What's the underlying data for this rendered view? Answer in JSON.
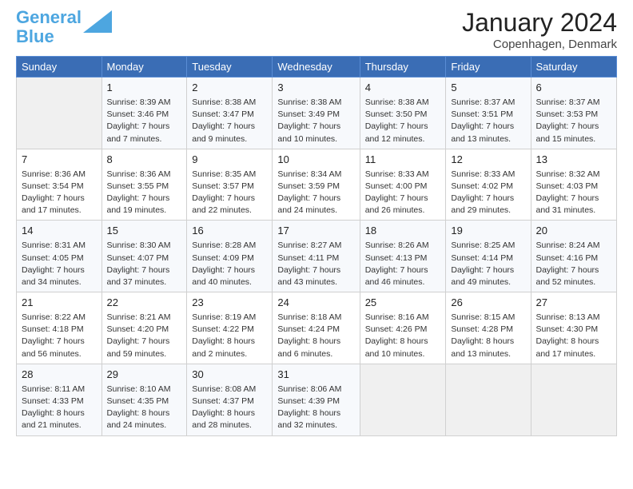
{
  "header": {
    "logo_line1": "General",
    "logo_line2": "Blue",
    "month_year": "January 2024",
    "location": "Copenhagen, Denmark"
  },
  "weekdays": [
    "Sunday",
    "Monday",
    "Tuesday",
    "Wednesday",
    "Thursday",
    "Friday",
    "Saturday"
  ],
  "weeks": [
    [
      {
        "day": "",
        "content": ""
      },
      {
        "day": "1",
        "content": "Sunrise: 8:39 AM\nSunset: 3:46 PM\nDaylight: 7 hours\nand 7 minutes."
      },
      {
        "day": "2",
        "content": "Sunrise: 8:38 AM\nSunset: 3:47 PM\nDaylight: 7 hours\nand 9 minutes."
      },
      {
        "day": "3",
        "content": "Sunrise: 8:38 AM\nSunset: 3:49 PM\nDaylight: 7 hours\nand 10 minutes."
      },
      {
        "day": "4",
        "content": "Sunrise: 8:38 AM\nSunset: 3:50 PM\nDaylight: 7 hours\nand 12 minutes."
      },
      {
        "day": "5",
        "content": "Sunrise: 8:37 AM\nSunset: 3:51 PM\nDaylight: 7 hours\nand 13 minutes."
      },
      {
        "day": "6",
        "content": "Sunrise: 8:37 AM\nSunset: 3:53 PM\nDaylight: 7 hours\nand 15 minutes."
      }
    ],
    [
      {
        "day": "7",
        "content": "Sunrise: 8:36 AM\nSunset: 3:54 PM\nDaylight: 7 hours\nand 17 minutes."
      },
      {
        "day": "8",
        "content": "Sunrise: 8:36 AM\nSunset: 3:55 PM\nDaylight: 7 hours\nand 19 minutes."
      },
      {
        "day": "9",
        "content": "Sunrise: 8:35 AM\nSunset: 3:57 PM\nDaylight: 7 hours\nand 22 minutes."
      },
      {
        "day": "10",
        "content": "Sunrise: 8:34 AM\nSunset: 3:59 PM\nDaylight: 7 hours\nand 24 minutes."
      },
      {
        "day": "11",
        "content": "Sunrise: 8:33 AM\nSunset: 4:00 PM\nDaylight: 7 hours\nand 26 minutes."
      },
      {
        "day": "12",
        "content": "Sunrise: 8:33 AM\nSunset: 4:02 PM\nDaylight: 7 hours\nand 29 minutes."
      },
      {
        "day": "13",
        "content": "Sunrise: 8:32 AM\nSunset: 4:03 PM\nDaylight: 7 hours\nand 31 minutes."
      }
    ],
    [
      {
        "day": "14",
        "content": "Sunrise: 8:31 AM\nSunset: 4:05 PM\nDaylight: 7 hours\nand 34 minutes."
      },
      {
        "day": "15",
        "content": "Sunrise: 8:30 AM\nSunset: 4:07 PM\nDaylight: 7 hours\nand 37 minutes."
      },
      {
        "day": "16",
        "content": "Sunrise: 8:28 AM\nSunset: 4:09 PM\nDaylight: 7 hours\nand 40 minutes."
      },
      {
        "day": "17",
        "content": "Sunrise: 8:27 AM\nSunset: 4:11 PM\nDaylight: 7 hours\nand 43 minutes."
      },
      {
        "day": "18",
        "content": "Sunrise: 8:26 AM\nSunset: 4:13 PM\nDaylight: 7 hours\nand 46 minutes."
      },
      {
        "day": "19",
        "content": "Sunrise: 8:25 AM\nSunset: 4:14 PM\nDaylight: 7 hours\nand 49 minutes."
      },
      {
        "day": "20",
        "content": "Sunrise: 8:24 AM\nSunset: 4:16 PM\nDaylight: 7 hours\nand 52 minutes."
      }
    ],
    [
      {
        "day": "21",
        "content": "Sunrise: 8:22 AM\nSunset: 4:18 PM\nDaylight: 7 hours\nand 56 minutes."
      },
      {
        "day": "22",
        "content": "Sunrise: 8:21 AM\nSunset: 4:20 PM\nDaylight: 7 hours\nand 59 minutes."
      },
      {
        "day": "23",
        "content": "Sunrise: 8:19 AM\nSunset: 4:22 PM\nDaylight: 8 hours\nand 2 minutes."
      },
      {
        "day": "24",
        "content": "Sunrise: 8:18 AM\nSunset: 4:24 PM\nDaylight: 8 hours\nand 6 minutes."
      },
      {
        "day": "25",
        "content": "Sunrise: 8:16 AM\nSunset: 4:26 PM\nDaylight: 8 hours\nand 10 minutes."
      },
      {
        "day": "26",
        "content": "Sunrise: 8:15 AM\nSunset: 4:28 PM\nDaylight: 8 hours\nand 13 minutes."
      },
      {
        "day": "27",
        "content": "Sunrise: 8:13 AM\nSunset: 4:30 PM\nDaylight: 8 hours\nand 17 minutes."
      }
    ],
    [
      {
        "day": "28",
        "content": "Sunrise: 8:11 AM\nSunset: 4:33 PM\nDaylight: 8 hours\nand 21 minutes."
      },
      {
        "day": "29",
        "content": "Sunrise: 8:10 AM\nSunset: 4:35 PM\nDaylight: 8 hours\nand 24 minutes."
      },
      {
        "day": "30",
        "content": "Sunrise: 8:08 AM\nSunset: 4:37 PM\nDaylight: 8 hours\nand 28 minutes."
      },
      {
        "day": "31",
        "content": "Sunrise: 8:06 AM\nSunset: 4:39 PM\nDaylight: 8 hours\nand 32 minutes."
      },
      {
        "day": "",
        "content": ""
      },
      {
        "day": "",
        "content": ""
      },
      {
        "day": "",
        "content": ""
      }
    ]
  ]
}
